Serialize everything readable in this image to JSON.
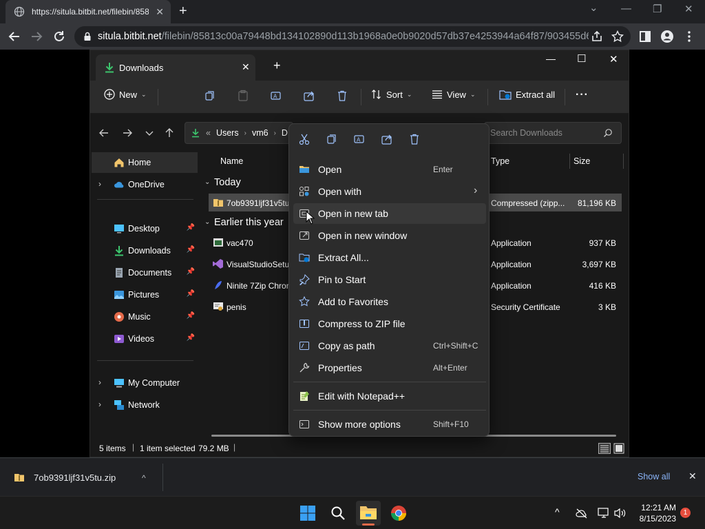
{
  "browser": {
    "tab_title": "https://situla.bitbit.net/filebin/858...",
    "tab_close": "✕",
    "new_tab": "+",
    "url_host": "situla.bitbit.net",
    "url_path": "/filebin/85813c00a79448bd134102890d113b1968a0e0b9020d57db37e4253944a64f87/903455d6...",
    "window_controls": {
      "dropdown": "⌄",
      "minimize": "—",
      "restore": "❐",
      "close": "✕"
    }
  },
  "explorer": {
    "tab_label": "Downloads",
    "tab_close": "✕",
    "new_tab": "+",
    "window_controls": {
      "minimize": "—",
      "maximize": "☐",
      "close": "✕"
    },
    "commandbar": {
      "new_label": "New",
      "sort_label": "Sort",
      "view_label": "View",
      "extract_all_label": "Extract all",
      "more_label": "···"
    },
    "address": {
      "crumbs_prefix": "«",
      "crumb_users": "Users",
      "crumb_vm6": "vm6",
      "crumb_truncated": "D"
    },
    "search_placeholder": "Search Downloads",
    "nav": {
      "home": "Home",
      "onedrive": "OneDrive",
      "desktop": "Desktop",
      "downloads": "Downloads",
      "documents": "Documents",
      "pictures": "Pictures",
      "music": "Music",
      "videos": "Videos",
      "my_computer": "My Computer",
      "network": "Network"
    },
    "columns": {
      "name": "Name",
      "type": "Type",
      "size": "Size"
    },
    "groups": {
      "today": "Today",
      "earlier": "Earlier this year"
    },
    "files": [
      {
        "name": "7ob9391ljf31v5tu",
        "type": "Compressed (zipp...",
        "size": "81,196 KB"
      },
      {
        "name": "vac470",
        "type": "Application",
        "size": "937 KB"
      },
      {
        "name": "VisualStudioSetup",
        "type": "Application",
        "size": "3,697 KB"
      },
      {
        "name": "Ninite 7Zip Chrome",
        "type": "Application",
        "size": "416 KB"
      },
      {
        "name": "penis",
        "type": "Security Certificate",
        "size": "3 KB"
      }
    ],
    "status": {
      "items": "5 items",
      "selected": "1 item selected",
      "selected_size": "79.2 MB"
    }
  },
  "context_menu": {
    "items": [
      {
        "label": "Open",
        "shortcut": "Enter"
      },
      {
        "label": "Open with",
        "shortcut": "›"
      },
      {
        "label": "Open in new tab",
        "shortcut": ""
      },
      {
        "label": "Open in new window",
        "shortcut": ""
      },
      {
        "label": "Extract All...",
        "shortcut": ""
      },
      {
        "label": "Pin to Start",
        "shortcut": ""
      },
      {
        "label": "Add to Favorites",
        "shortcut": ""
      },
      {
        "label": "Compress to ZIP file",
        "shortcut": ""
      },
      {
        "label": "Copy as path",
        "shortcut": "Ctrl+Shift+C"
      },
      {
        "label": "Properties",
        "shortcut": "Alt+Enter"
      },
      {
        "label": "Edit with Notepad++",
        "shortcut": ""
      },
      {
        "label": "Show more options",
        "shortcut": "Shift+F10"
      }
    ]
  },
  "downloads_shelf": {
    "file_name": "7ob9391ljf31v5tu.zip",
    "chevron": "^",
    "show_all": "Show all",
    "close": "✕"
  },
  "taskbar": {
    "time": "12:21 AM",
    "date": "8/15/2023",
    "notification_count": "1"
  },
  "colors": {
    "chrome_bg": "#202124",
    "chrome_toolbar": "#35363a",
    "explorer_bg": "#191919",
    "menu_bg": "#2c2c2c",
    "accent_blue": "#0078d4",
    "link_blue": "#8ab4f8",
    "badge_red": "#e84d3d"
  }
}
